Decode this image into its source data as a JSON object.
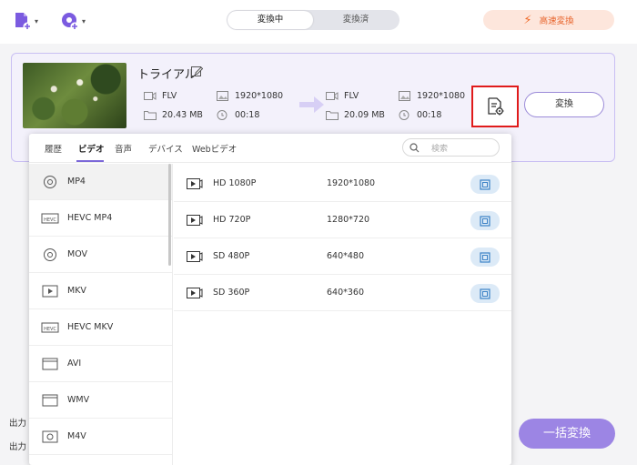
{
  "toolbar": {
    "add_file_icon": "add-file-icon",
    "add_disc_icon": "add-disc-icon",
    "caret": "▾"
  },
  "tabs": {
    "converting": "変換中",
    "converted": "変換済"
  },
  "fast_convert": {
    "label": "高速変換",
    "icon": "lightning-icon",
    "color": "#e8642c"
  },
  "file": {
    "title": "トライアル",
    "source": {
      "format": "FLV",
      "resolution": "1920*1080",
      "size": "20.43 MB",
      "duration": "00:18"
    },
    "target": {
      "format": "FLV",
      "resolution": "1920*1080",
      "size": "20.09 MB",
      "duration": "00:18"
    },
    "convert_label": "変換"
  },
  "bottom": {
    "label1": "出力",
    "label2": "出力",
    "bulk_convert": "一括変換",
    "accent": "#9c85e4"
  },
  "format_popup": {
    "tabs": [
      "履歴",
      "ビデオ",
      "音声",
      "デバイス",
      "Webビデオ"
    ],
    "active_tab": "ビデオ",
    "search_placeholder": "検索",
    "formats": [
      {
        "label": "MP4",
        "icon": "disc-icon"
      },
      {
        "label": "HEVC MP4",
        "icon": "hevc-icon"
      },
      {
        "label": "MOV",
        "icon": "disc-icon"
      },
      {
        "label": "MKV",
        "icon": "video-icon"
      },
      {
        "label": "HEVC MKV",
        "icon": "hevc-icon"
      },
      {
        "label": "AVI",
        "icon": "clapper-icon"
      },
      {
        "label": "WMV",
        "icon": "clapper-icon"
      },
      {
        "label": "M4V",
        "icon": "video-icon"
      }
    ],
    "selected_format": "MP4",
    "presets": [
      {
        "name": "HD 1080P",
        "resolution": "1920*1080"
      },
      {
        "name": "HD 720P",
        "resolution": "1280*720"
      },
      {
        "name": "SD 480P",
        "resolution": "640*480"
      },
      {
        "name": "SD 360P",
        "resolution": "640*360"
      }
    ],
    "accent": "#7b67d8"
  }
}
